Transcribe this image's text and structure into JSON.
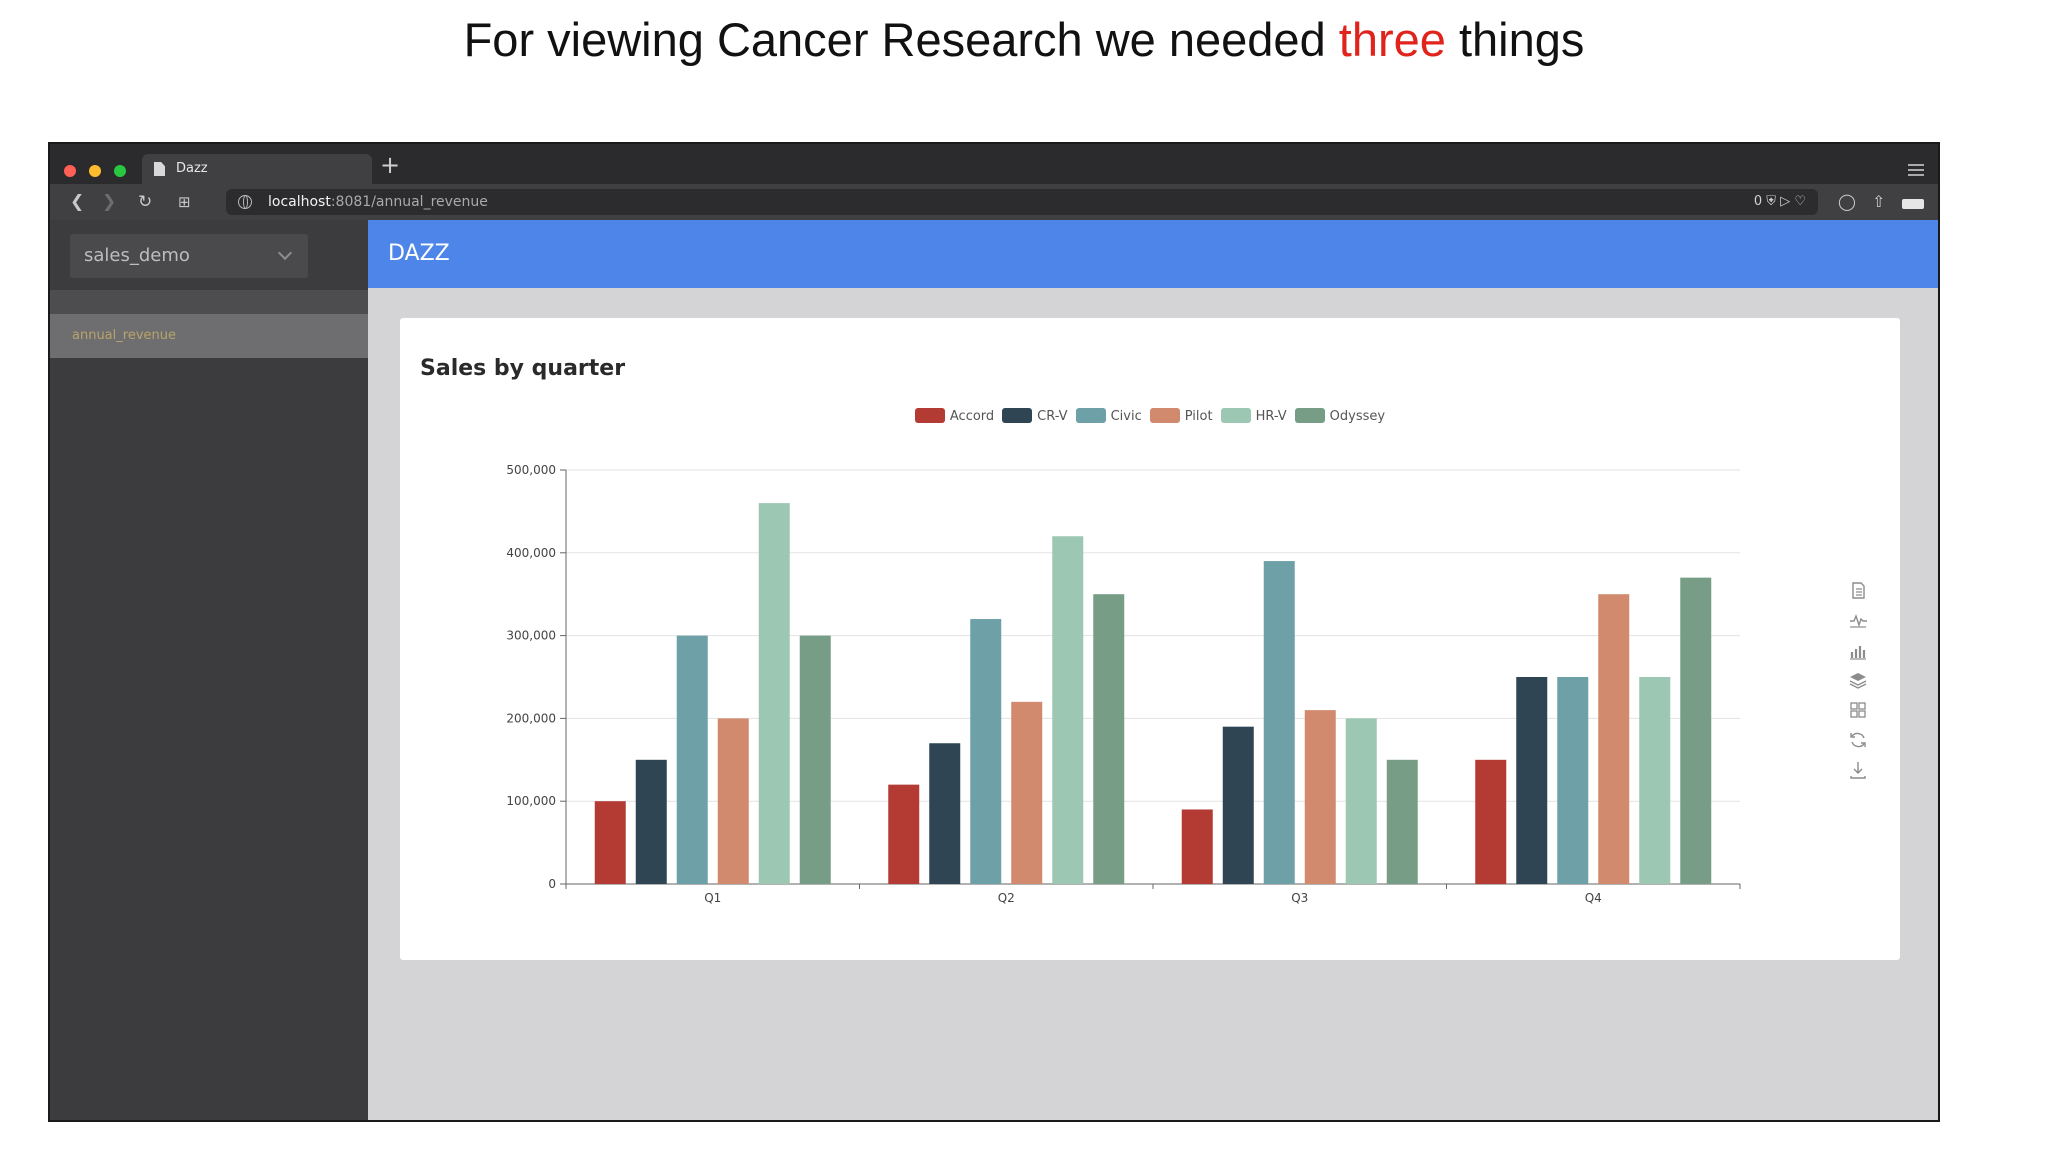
{
  "slide": {
    "title_before": "For viewing Cancer Research we needed ",
    "title_highlight": "three",
    "title_after": " things"
  },
  "browser": {
    "tab_title": "Dazz",
    "new_tab": "+",
    "url_host": "localhost",
    "url_rest": ":8081/annual_revenue",
    "url_badge": "0"
  },
  "sidebar": {
    "database": "sales_demo",
    "items": [
      {
        "label": "annual_revenue"
      }
    ]
  },
  "header": {
    "title": "DAZZ"
  },
  "colors": {
    "app_header": "#4d86e8",
    "highlight_text": "#e0241c"
  },
  "toolbox": {
    "icons": [
      "data-view-icon",
      "line-chart-icon",
      "bar-chart-icon",
      "stack-icon",
      "tiled-icon",
      "restore-icon",
      "save-image-icon"
    ]
  },
  "chart_data": {
    "type": "bar",
    "title": "Sales by quarter",
    "categories": [
      "Q1",
      "Q2",
      "Q3",
      "Q4"
    ],
    "ylim": [
      0,
      500000
    ],
    "yticks": [
      "0",
      "100,000",
      "200,000",
      "300,000",
      "400,000",
      "500,000"
    ],
    "ytick_values": [
      0,
      100000,
      200000,
      300000,
      400000,
      500000
    ],
    "grid": true,
    "legend_position": "top-center",
    "series": [
      {
        "name": "Accord",
        "color": "#b33b33",
        "values": [
          100000,
          120000,
          90000,
          150000
        ]
      },
      {
        "name": "CR-V",
        "color": "#2f4553",
        "values": [
          150000,
          170000,
          190000,
          250000
        ]
      },
      {
        "name": "Civic",
        "color": "#6ea0a8",
        "values": [
          300000,
          320000,
          390000,
          250000
        ]
      },
      {
        "name": "Pilot",
        "color": "#d18a6e",
        "values": [
          200000,
          220000,
          210000,
          350000
        ]
      },
      {
        "name": "HR-V",
        "color": "#9cc7b2",
        "values": [
          460000,
          420000,
          200000,
          250000
        ]
      },
      {
        "name": "Odyssey",
        "color": "#789d86",
        "values": [
          300000,
          350000,
          150000,
          370000
        ]
      }
    ]
  }
}
